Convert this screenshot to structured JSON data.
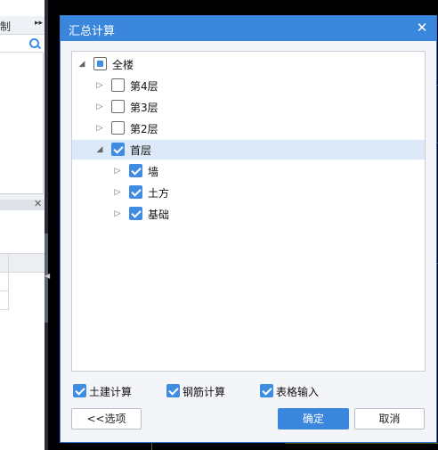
{
  "background": {
    "toolbar_label": "制",
    "toolbar_arrow": "▸▸",
    "panel_close": "✕",
    "splitter_arrow": "◀"
  },
  "dialog": {
    "title": "汇总计算",
    "close_glyph": "✕",
    "tree": [
      {
        "label": "全楼",
        "state": "partial",
        "expanded": true,
        "level": 0
      },
      {
        "label": "第4层",
        "state": "unchecked",
        "expanded": false,
        "level": 1
      },
      {
        "label": "第3层",
        "state": "unchecked",
        "expanded": false,
        "level": 1
      },
      {
        "label": "第2层",
        "state": "unchecked",
        "expanded": false,
        "level": 1
      },
      {
        "label": "首层",
        "state": "checked",
        "expanded": true,
        "level": 1,
        "selected": true
      },
      {
        "label": "墙",
        "state": "checked",
        "expanded": false,
        "level": 2
      },
      {
        "label": "土方",
        "state": "checked",
        "expanded": false,
        "level": 2
      },
      {
        "label": "基础",
        "state": "checked",
        "expanded": false,
        "level": 2
      }
    ],
    "options": [
      {
        "label": "土建计算",
        "checked": true
      },
      {
        "label": "钢筋计算",
        "checked": true
      },
      {
        "label": "表格输入",
        "checked": true
      }
    ],
    "buttons": {
      "options": "<<选项",
      "ok": "确定",
      "cancel": "取消"
    }
  },
  "colors": {
    "accent": "#3a86dc",
    "checkbox": "#3f8de3",
    "selected_row": "#dbe9f8"
  }
}
